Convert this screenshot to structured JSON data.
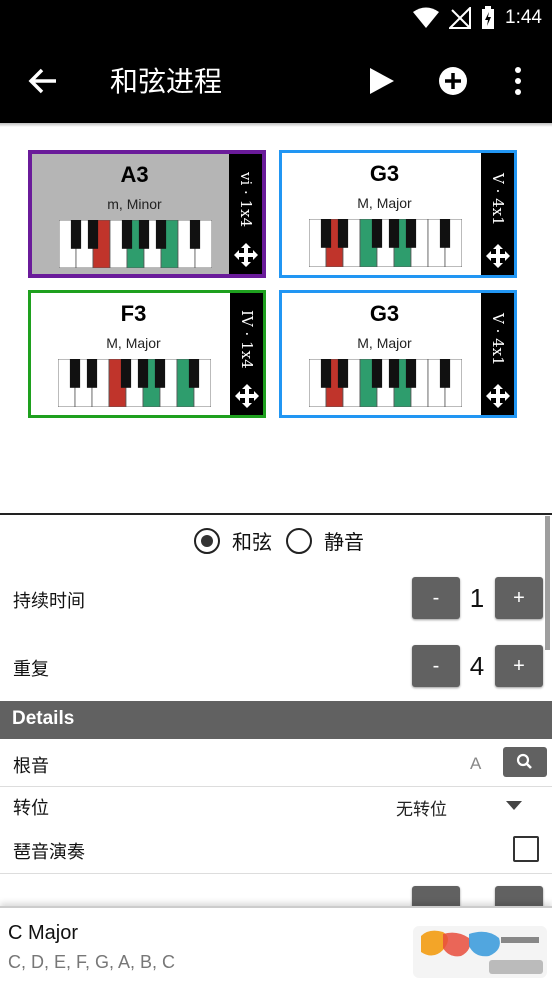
{
  "status": {
    "time": "1:44"
  },
  "appbar": {
    "title": "和弦进程"
  },
  "chords": [
    {
      "name": "A3",
      "type": "m, Minor",
      "side": "vi · 1x4",
      "border": "#6a1b9a",
      "bg": "#b5b5b5",
      "width": 4,
      "highlights": {
        "red": [
          2
        ],
        "green": [
          4,
          6
        ]
      }
    },
    {
      "name": "G3",
      "type": "M, Major",
      "side": "V · 4x1",
      "border": "#2196f3",
      "bg": "#ffffff",
      "width": 3,
      "highlights": {
        "red": [
          1
        ],
        "green": [
          3,
          5
        ]
      }
    },
    {
      "name": "F3",
      "type": "M, Major",
      "side": "IV · 1x4",
      "border": "#1ea01e",
      "bg": "#ffffff",
      "width": 3,
      "highlights": {
        "red": [
          3
        ],
        "green": [
          5,
          7
        ]
      }
    },
    {
      "name": "G3",
      "type": "M, Major",
      "side": "V · 4x1",
      "border": "#2196f3",
      "bg": "#ffffff",
      "width": 3,
      "highlights": {
        "red": [
          1
        ],
        "green": [
          3,
          5
        ]
      }
    }
  ],
  "colors": {
    "red": "#c0342b",
    "green": "#2e9d6d",
    "gray_button": "#616161"
  },
  "mode": {
    "chord_label": "和弦",
    "mute_label": "静音",
    "selected": "chord"
  },
  "duration": {
    "label": "持续时间",
    "value": "1",
    "minus": "-",
    "plus": "+"
  },
  "repeat": {
    "label": "重复",
    "value": "4",
    "minus": "-",
    "plus": "+"
  },
  "details": {
    "header": "Details",
    "root_label": "根音",
    "root_value": "A",
    "inversion_label": "转位",
    "inversion_value": "无转位",
    "arpeggio_label": "琶音演奏"
  },
  "bottom": {
    "key_name": "C Major",
    "key_notes": "C, D, E, F, G, A, B, C"
  }
}
